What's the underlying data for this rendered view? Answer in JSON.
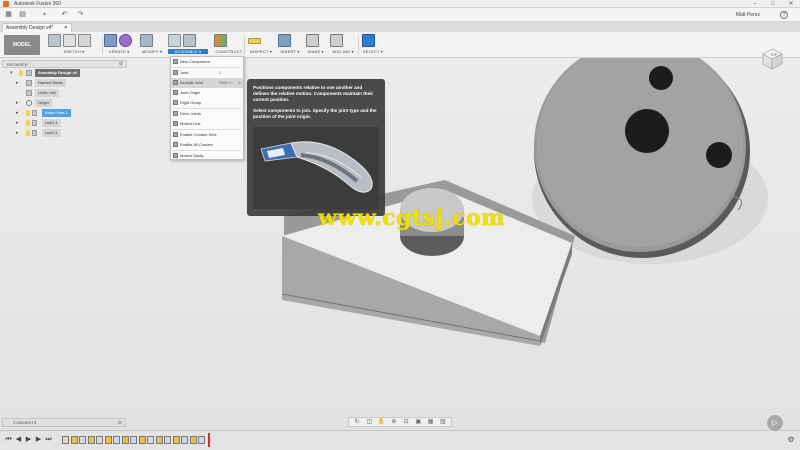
{
  "window": {
    "title": "Autodesk Fusion 360",
    "controls": [
      "–",
      "□",
      "✕"
    ]
  },
  "quick_access": {
    "user_name": "Matt Perez",
    "help_label": "?"
  },
  "document": {
    "tab_label": "Assembly Design v4*",
    "tab_close": "✕"
  },
  "ribbon": {
    "workspace": "MODEL",
    "groups": [
      {
        "label": "SKETCH ▾"
      },
      {
        "label": "CREATE ▾"
      },
      {
        "label": "MODIFY ▾"
      },
      {
        "label": "ASSEMBLE ▾"
      },
      {
        "label": "CONSTRUCT ▾"
      },
      {
        "label": "INSPECT ▾"
      },
      {
        "label": "INSERT ▾"
      },
      {
        "label": "MAKE ▾"
      },
      {
        "label": "ADD-INS ▾"
      },
      {
        "label": "SELECT ▾"
      }
    ]
  },
  "browser": {
    "header": "BROWSER",
    "items": [
      {
        "label": "Assembly Design v4"
      },
      {
        "label": "Named Views"
      },
      {
        "label": "Units: mm"
      },
      {
        "label": "Origin"
      },
      {
        "label": "Base Plate:1"
      },
      {
        "label": "Link1:1"
      },
      {
        "label": "Link2:1"
      }
    ]
  },
  "assemble_menu": {
    "items": [
      {
        "label": "New Component",
        "shortcut": ""
      },
      {
        "label": "Joint",
        "shortcut": "J"
      },
      {
        "label": "As-built Joint",
        "shortcut": "Shift+J"
      },
      {
        "label": "Joint Origin",
        "shortcut": ""
      },
      {
        "label": "Rigid Group",
        "shortcut": ""
      },
      {
        "label": "Drive Joints",
        "shortcut": ""
      },
      {
        "label": "Motion Link",
        "shortcut": ""
      },
      {
        "label": "Enable Contact Sets",
        "shortcut": ""
      },
      {
        "label": "Enable All Contact",
        "shortcut": ""
      },
      {
        "label": "Motion Study",
        "shortcut": ""
      }
    ]
  },
  "tooltip": {
    "line1": "Positions components relative to one another and defines the relative motion. Components maintain their current position.",
    "line2": "Select components to join. Specify the joint type and the position of the joint origin."
  },
  "viewcube": {
    "face_label": "TOP"
  },
  "watermark": "www.cgtsj.com",
  "comments": {
    "label": "COMMENTS"
  },
  "colors": {
    "accent": "#2f7ec8",
    "selection": "#4ea3e6",
    "watermark": "#f2e000"
  }
}
